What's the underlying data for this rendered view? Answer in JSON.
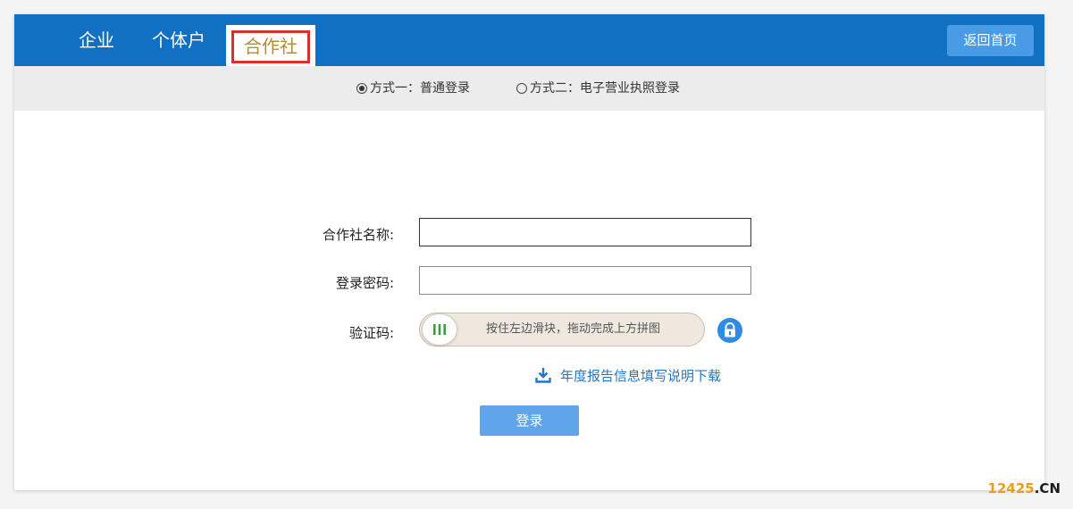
{
  "header": {
    "tabs": [
      {
        "label": "企业"
      },
      {
        "label": "个体户"
      },
      {
        "label": "合作社"
      }
    ],
    "active_tab": "合作社",
    "home_label": "返回首页"
  },
  "login_modes": [
    {
      "label": "方式一：普通登录",
      "selected": true
    },
    {
      "label": "方式二：电子营业执照登录",
      "selected": false
    }
  ],
  "form": {
    "name_label": "合作社名称:",
    "name_value": "",
    "password_label": "登录密码:",
    "password_value": "",
    "captcha_label": "验证码:",
    "slider_text": "按住左边滑块，拖动完成上方拼图",
    "download_label": "年度报告信息填写说明下载",
    "login_label": "登录"
  },
  "watermark": {
    "number": "12425",
    "suffix": ".CN"
  },
  "colors": {
    "header_bg": "#1170c2",
    "active_tab_text": "#b48d32",
    "highlight_box": "#d8312a",
    "home_button": "#4a9be5",
    "login_button": "#5fa5ea",
    "link": "#1f77c8",
    "slider_grip": "#3aa13a",
    "lock_badge": "#2e8be6",
    "watermark": "#f39a1e"
  }
}
